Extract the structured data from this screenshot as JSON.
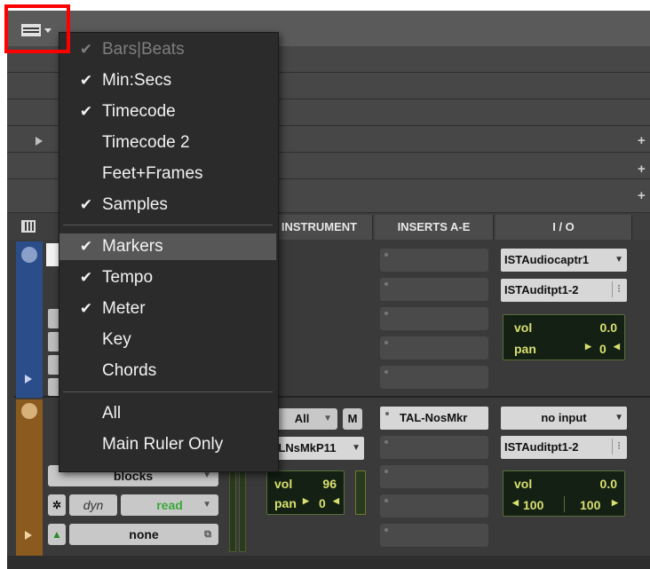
{
  "accent": "#ff0000",
  "ruler_menu": {
    "items_top": [
      {
        "label": "Bars|Beats",
        "checked": true,
        "disabled": true
      },
      {
        "label": "Min:Secs",
        "checked": true
      },
      {
        "label": "Timecode",
        "checked": true
      },
      {
        "label": "Timecode 2",
        "checked": false
      },
      {
        "label": "Feet+Frames",
        "checked": false
      },
      {
        "label": "Samples",
        "checked": true
      }
    ],
    "items_mid": [
      {
        "label": "Markers",
        "checked": true,
        "highlighted": true
      },
      {
        "label": "Tempo",
        "checked": true
      },
      {
        "label": "Meter",
        "checked": true
      },
      {
        "label": "Key",
        "checked": false
      },
      {
        "label": "Chords",
        "checked": false
      }
    ],
    "items_bottom": [
      {
        "label": "All"
      },
      {
        "label": "Main Ruler Only"
      }
    ],
    "check_glyph": "✔"
  },
  "columns": {
    "instrument": "INSTRUMENT",
    "inserts": "INSERTS A-E",
    "io": "I / O"
  },
  "track1": {
    "io_input": "ISTAudiocaptr1",
    "io_output": "ISTAuditpt1-2",
    "vol_label": "vol",
    "vol_value": "0.0",
    "pan_label": "pan",
    "pan_value": "0"
  },
  "track2": {
    "instrument_select": "All",
    "mute_label": "M",
    "instrument_plugin": "ALNsMkP11",
    "insert_a": "TAL-NosMkr",
    "io_input": "no input",
    "io_output": "ISTAuditpt1-2",
    "inst_vol_label": "vol",
    "inst_vol_value": "96",
    "inst_pan_label": "pan",
    "inst_pan_value": "0",
    "vol_label": "vol",
    "vol_value": "0.0",
    "pan_left": "100",
    "pan_right": "100",
    "playlist": "blocks",
    "dyn_label": "dyn",
    "automation_mode": "read",
    "group": "none"
  }
}
